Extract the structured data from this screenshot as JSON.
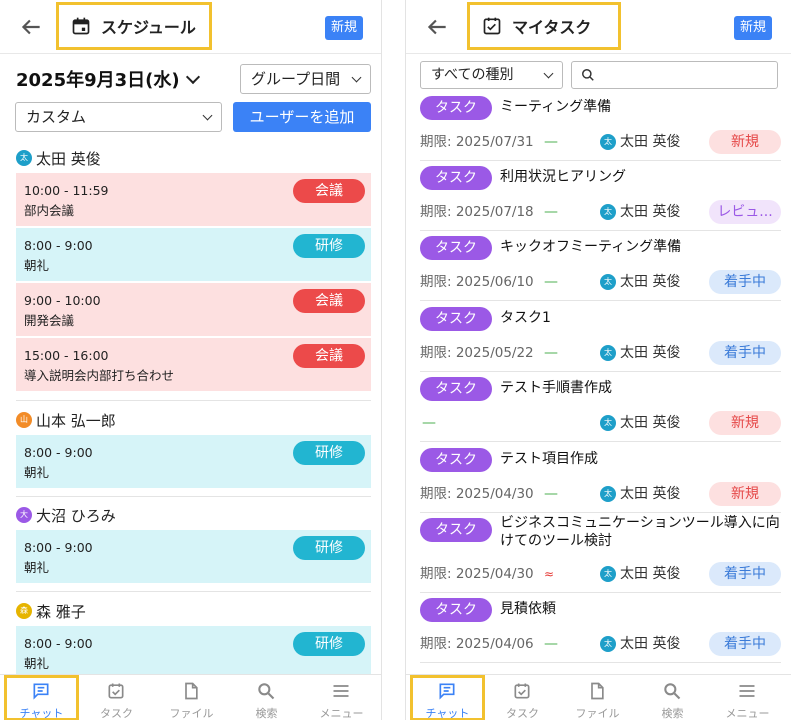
{
  "left": {
    "title": "スケジュール",
    "new_label": "新規",
    "date_label": "2025年9月3日(水)",
    "group_select": "グループ日間",
    "custom_select": "カスタム",
    "add_user_label": "ユーザーを追加",
    "users": [
      {
        "name": "太田 英俊",
        "avatar_char": "太",
        "avatar_color": "#1e9fc9",
        "events": [
          {
            "time": "10:00 - 11:59",
            "name": "部内会議",
            "type": "会議",
            "kind": "meet"
          },
          {
            "time": "8:00 - 9:00",
            "name": "朝礼",
            "type": "研修",
            "kind": "train"
          },
          {
            "time": "9:00 - 10:00",
            "name": "開発会議",
            "type": "会議",
            "kind": "meet"
          },
          {
            "time": "15:00 - 16:00",
            "name": "導入説明会内部打ち合わせ",
            "type": "会議",
            "kind": "meet"
          }
        ]
      },
      {
        "name": "山本 弘一郎",
        "avatar_char": "山",
        "avatar_color": "#f28c28",
        "events": [
          {
            "time": "8:00 - 9:00",
            "name": "朝礼",
            "type": "研修",
            "kind": "train"
          }
        ]
      },
      {
        "name": "大沼 ひろみ",
        "avatar_char": "大",
        "avatar_color": "#9b59e6",
        "events": [
          {
            "time": "8:00 - 9:00",
            "name": "朝礼",
            "type": "研修",
            "kind": "train"
          }
        ]
      },
      {
        "name": "森 雅子",
        "avatar_char": "森",
        "avatar_color": "#e6b400",
        "events": [
          {
            "time": "8:00 - 9:00",
            "name": "朝礼",
            "type": "研修",
            "kind": "train"
          }
        ]
      }
    ]
  },
  "right": {
    "title": "マイタスク",
    "new_label": "新規",
    "filter_select": "すべての種別",
    "tasks": [
      {
        "tag": "タスク",
        "name": "ミーティング準備",
        "due": "期限: 2025/07/31",
        "priority": "—",
        "assignee": "太田 英俊",
        "avatar_char": "太",
        "status": "新規",
        "status_kind": "new"
      },
      {
        "tag": "タスク",
        "name": "利用状況ヒアリング",
        "due": "期限: 2025/07/18",
        "priority": "—",
        "assignee": "太田 英俊",
        "avatar_char": "太",
        "status": "レビュ...",
        "status_kind": "review"
      },
      {
        "tag": "タスク",
        "name": "キックオフミーティング準備",
        "due": "期限: 2025/06/10",
        "priority": "—",
        "assignee": "太田 英俊",
        "avatar_char": "太",
        "status": "着手中",
        "status_kind": "progress"
      },
      {
        "tag": "タスク",
        "name": "タスク1",
        "due": "期限: 2025/05/22",
        "priority": "—",
        "assignee": "太田 英俊",
        "avatar_char": "太",
        "status": "着手中",
        "status_kind": "progress"
      },
      {
        "tag": "タスク",
        "name": "テスト手順書作成",
        "due": "",
        "priority": "—",
        "assignee": "太田 英俊",
        "avatar_char": "太",
        "status": "新規",
        "status_kind": "new"
      },
      {
        "tag": "タスク",
        "name": "テスト項目作成",
        "due": "期限: 2025/04/30",
        "priority": "—",
        "assignee": "太田 英俊",
        "avatar_char": "太",
        "status": "新規",
        "status_kind": "new"
      },
      {
        "tag": "タスク",
        "name": "ビジネスコミュニケーションツール導入に向けてのツール検討",
        "due": "期限: 2025/04/30",
        "priority": "≈",
        "assignee": "太田 英俊",
        "avatar_char": "太",
        "status": "着手中",
        "status_kind": "progress"
      },
      {
        "tag": "タスク",
        "name": "見積依頼",
        "due": "期限: 2025/04/06",
        "priority": "—",
        "assignee": "太田 英俊",
        "avatar_char": "太",
        "status": "着手中",
        "status_kind": "progress"
      }
    ]
  },
  "nav": {
    "items": [
      {
        "label": "チャット",
        "icon": "chat-icon"
      },
      {
        "label": "タスク",
        "icon": "task-icon"
      },
      {
        "label": "ファイル",
        "icon": "file-icon"
      },
      {
        "label": "検索",
        "icon": "search-icon"
      },
      {
        "label": "メニュー",
        "icon": "menu-icon"
      }
    ],
    "active_index": 0
  },
  "colors": {
    "accent": "#3b82f6",
    "highlight": "#f2c12e",
    "meeting": "#ec4a4a",
    "training": "#22b5d1",
    "task_tag": "#9b59e6"
  }
}
